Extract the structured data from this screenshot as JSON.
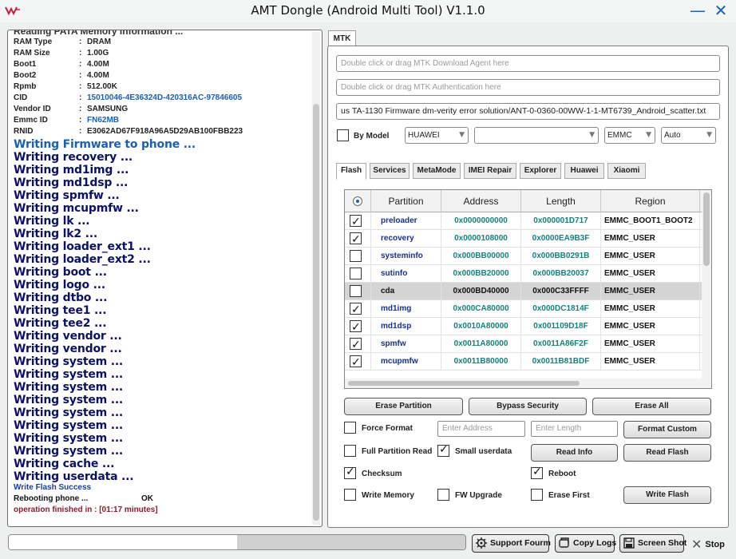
{
  "window": {
    "title": "AMT Dongle (Android Multi Tool) V1.1.0",
    "minimize": "—",
    "close": "✕"
  },
  "log": {
    "cut_header": "Reading PATA Memory Information ...",
    "info": [
      {
        "key": "RAM Type",
        "sep": ":",
        "value": "DRAM",
        "blue": false
      },
      {
        "key": "RAM Size",
        "sep": ":",
        "value": "1.00G",
        "blue": false
      },
      {
        "key": "Boot1",
        "sep": ":",
        "value": "4.00M",
        "blue": false
      },
      {
        "key": "Boot2",
        "sep": ":",
        "value": "4.00M",
        "blue": false
      },
      {
        "key": "Rpmb",
        "sep": ":",
        "value": "512.00K",
        "blue": false
      },
      {
        "key": "CID",
        "sep": ":",
        "value": "15010046-4E36324D-420316AC-97846605",
        "blue": true
      },
      {
        "key": "Vendor ID",
        "sep": ":",
        "value": "SAMSUNG",
        "blue": false
      },
      {
        "key": "Emmc ID",
        "sep": ":",
        "value": "FN62MB",
        "blue": true
      },
      {
        "key": "RNID",
        "sep": ":",
        "value": "E3062AD67F918A96A5D29AB100FBB223",
        "blue": false
      }
    ],
    "lines": [
      "Writing Firmware to phone ...",
      "Writing recovery ...",
      "Writing md1img ...",
      "Writing md1dsp ...",
      "Writing spmfw ...",
      "Writing mcupmfw ...",
      "Writing lk ...",
      "Writing lk2 ...",
      "Writing loader_ext1 ...",
      "Writing loader_ext2 ...",
      "Writing boot ...",
      "Writing logo ...",
      "Writing dtbo ...",
      "Writing tee1 ...",
      "Writing tee2 ...",
      "Writing vendor ...",
      "Writing vendor ...",
      "Writing system ...",
      "Writing system ...",
      "Writing system ...",
      "Writing system ...",
      "Writing system ...",
      "Writing system ...",
      "Writing system ...",
      "Writing system ...",
      "Writing cache ...",
      "Writing userdata ..."
    ],
    "success": "Write Flash Success",
    "rebooting": "Rebooting phone ...",
    "rebooting_status": "OK",
    "finished": "operation finished in : [01:17 minutes]"
  },
  "mtk": {
    "tab_label": "MTK",
    "download_agent_placeholder": "Double click or drag MTK Download Agent here",
    "auth_placeholder": "Double click or drag MTK Authentication here",
    "scatter_path": "us TA-1130 Firmware dm-verity error solution/ANT-0-0360-00WW-1-1-MT6739_Android_scatter.txt",
    "by_model_label": "By Model",
    "by_model_checked": false,
    "brand": "HUAWEI",
    "model": "",
    "storage": "EMMC",
    "mode": "Auto"
  },
  "subtabs": [
    "Flash",
    "Services",
    "MetaMode",
    "IMEI Repair",
    "Explorer",
    "Huawei",
    "Xiaomi"
  ],
  "grid": {
    "headers": [
      "Partition",
      "Address",
      "Length",
      "Region"
    ],
    "rows": [
      {
        "checked": true,
        "partition": "preloader",
        "address": "0x0000000000",
        "length": "0x000001D717",
        "region": "EMMC_BOOT1_BOOT2",
        "selected": false
      },
      {
        "checked": true,
        "partition": "recovery",
        "address": "0x0000108000",
        "length": "0x0000EA9B3F",
        "region": "EMMC_USER",
        "selected": false
      },
      {
        "checked": false,
        "partition": "systeminfo",
        "address": "0x000BB00000",
        "length": "0x000BB0291B",
        "region": "EMMC_USER",
        "selected": false
      },
      {
        "checked": false,
        "partition": "sutinfo",
        "address": "0x000BB20000",
        "length": "0x000BB20037",
        "region": "EMMC_USER",
        "selected": false
      },
      {
        "checked": false,
        "partition": "cda",
        "address": "0x000BD40000",
        "length": "0x000C33FFFF",
        "region": "EMMC_USER",
        "selected": true
      },
      {
        "checked": true,
        "partition": "md1img",
        "address": "0x000CA80000",
        "length": "0x000DC1814F",
        "region": "EMMC_USER",
        "selected": false
      },
      {
        "checked": true,
        "partition": "md1dsp",
        "address": "0x0010A80000",
        "length": "0x001109D18F",
        "region": "EMMC_USER",
        "selected": false
      },
      {
        "checked": true,
        "partition": "spmfw",
        "address": "0x0011A80000",
        "length": "0x0011A86F2F",
        "region": "EMMC_USER",
        "selected": false
      },
      {
        "checked": true,
        "partition": "mcupmfw",
        "address": "0x0011B80000",
        "length": "0x0011B81BDF",
        "region": "EMMC_USER",
        "selected": false
      }
    ]
  },
  "actions": {
    "erase_partition": "Erase Partition",
    "bypass_security": "Bypass Security",
    "erase_all": "Erase All",
    "force_format": "Force Format",
    "enter_address": "Enter Address",
    "enter_length": "Enter Length",
    "format_custom": "Format Custom",
    "full_partition_read": "Full Partition Read",
    "small_userdata": "Small userdata",
    "read_info": "Read Info",
    "read_flash": "Read Flash",
    "checksum": "Checksum",
    "reboot": "Reboot",
    "write_memory": "Write Memory",
    "fw_upgrade": "FW Upgrade",
    "erase_first": "Erase First",
    "write_flash": "Write Flash",
    "force_format_checked": false,
    "full_partition_read_checked": false,
    "small_userdata_checked": true,
    "checksum_checked": true,
    "reboot_checked": true,
    "write_memory_checked": false,
    "fw_upgrade_checked": false,
    "erase_first_checked": false
  },
  "bottom": {
    "progress_fraction": 0.5,
    "support_forum": "Support Fourm",
    "copy_logs": "Copy Logs",
    "screen_shot": "Screen Shot",
    "stop": "Stop"
  },
  "colors": {
    "accent_blue": "#1b5fb3",
    "log_navy": "#0b1266",
    "address_teal": "#16807a"
  }
}
